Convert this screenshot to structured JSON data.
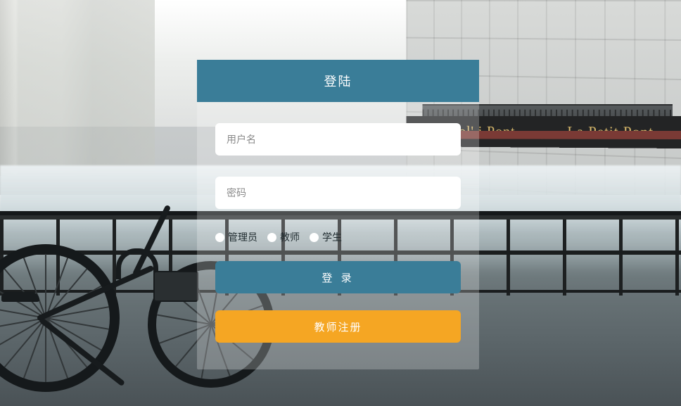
{
  "header": {
    "title": "登陆"
  },
  "fields": {
    "username": {
      "placeholder": "用户名",
      "value": ""
    },
    "password": {
      "placeholder": "密码",
      "value": ""
    }
  },
  "roles": {
    "options": [
      {
        "label": "管理员"
      },
      {
        "label": "教师"
      },
      {
        "label": "学生"
      }
    ]
  },
  "buttons": {
    "login": "登 录",
    "register": "教师注册"
  },
  "decor": {
    "shop_sign_left": "La Pol' i Pont",
    "shop_sign_right": "La Petit Pont"
  }
}
